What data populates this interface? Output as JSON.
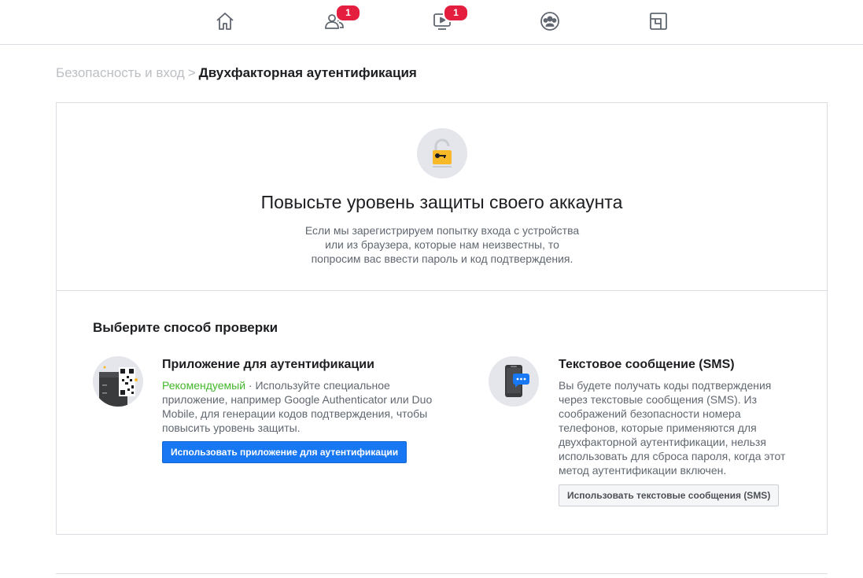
{
  "nav": {
    "items": [
      {
        "name": "home",
        "icon": "home-icon",
        "badge": ""
      },
      {
        "name": "friends",
        "icon": "friends-icon",
        "badge": "1"
      },
      {
        "name": "watch",
        "icon": "watch-icon",
        "badge": "1"
      },
      {
        "name": "groups",
        "icon": "groups-icon",
        "badge": ""
      },
      {
        "name": "gaming",
        "icon": "gaming-icon",
        "badge": ""
      }
    ]
  },
  "breadcrumb": {
    "parent": "Безопасность и вход",
    "separator": ">",
    "current": "Двухфакторная аутентификация"
  },
  "hero": {
    "icon": "lock-key-icon",
    "title": "Повысьте уровень защиты своего аккаунта",
    "description_lines": [
      "Если мы зарегистрируем попытку входа с устройства",
      "или из браузера, которые нам неизвестны, то",
      "попросим вас ввести пароль и код подтверждения."
    ]
  },
  "methods": {
    "title": "Выберите способ проверки",
    "app": {
      "icon": "qr-code-icon",
      "title": "Приложение для аутентификации",
      "recommended": "Рекомендуемый",
      "desc_lines": [
        " · Используйте специальное",
        "приложение, например Google Authenticator или Duo",
        "Mobile, для генерации кодов подтверждения, чтобы",
        "повысить уровень защиты."
      ],
      "button": "Использовать приложение для аутентификации"
    },
    "sms": {
      "icon": "phone-message-icon",
      "title": "Текстовое сообщение (SMS)",
      "desc_lines": [
        "Вы будете получать коды подтверждения",
        "через текстовые сообщения (SMS). Из",
        "соображений безопасности номера",
        "телефонов, которые применяются для",
        "двухфакторной аутентификации, нельзя",
        "использовать для сброса пароля, когда этот",
        "метод аутентификации включен."
      ],
      "button": "Использовать текстовые сообщения (SMS)"
    }
  },
  "colors": {
    "accent": "#1877f2",
    "badge": "#e41e3f",
    "recommended": "#42b72a",
    "lock": "#f7b928"
  }
}
